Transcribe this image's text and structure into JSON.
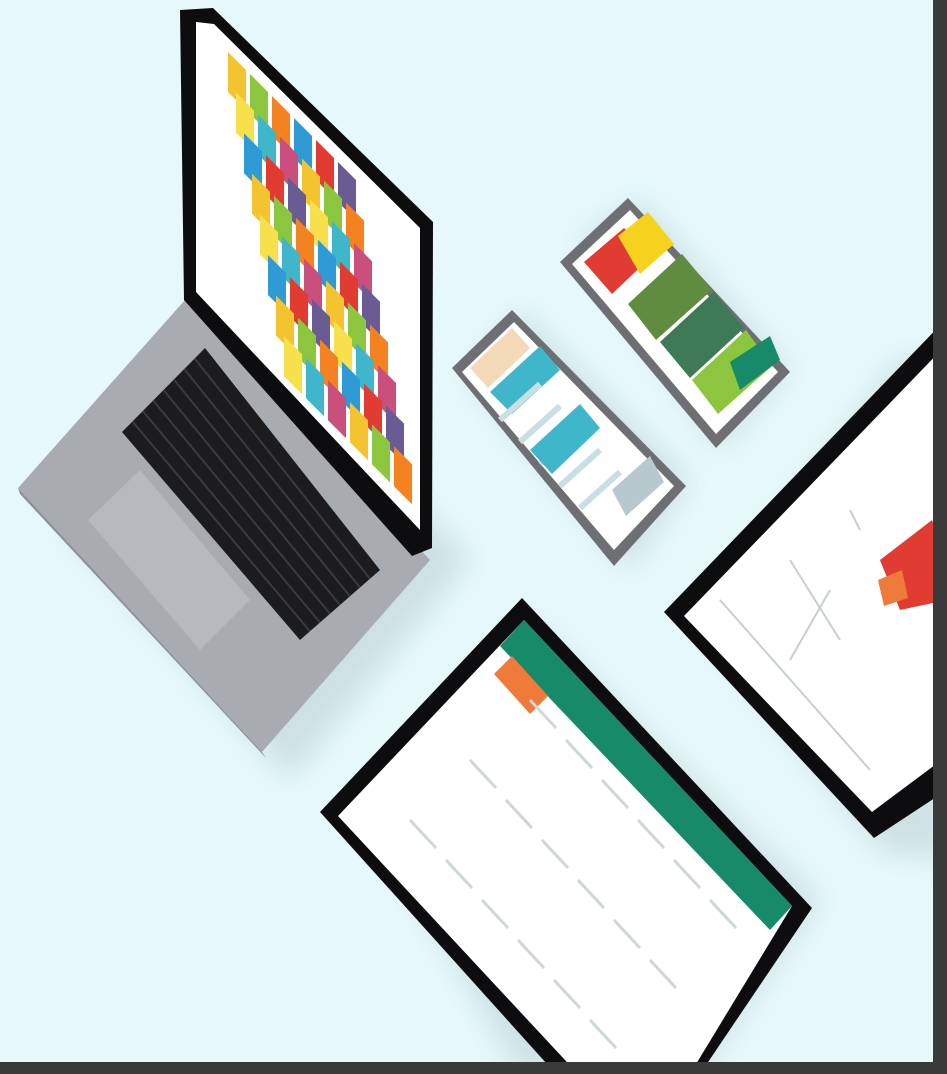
{
  "scene": {
    "background": "#e6f8fa",
    "right_edge_color": "#3a3a3a",
    "bottom_edge_color": "#3a3a3a",
    "palette": {
      "laptop_body": "#a8abb0",
      "laptop_body_shadow": "#8e9196",
      "keyboard": "#1c1c1e",
      "bezel": "#0d0d0f",
      "screen": "#ffffff",
      "accent_green": "#178a6a",
      "accent_orange": "#f07a3a",
      "tile_colors": [
        "#f4c430",
        "#8cc63f",
        "#f58220",
        "#2e9bd6",
        "#e03c31",
        "#6b5b95",
        "#f7e04b",
        "#3fb6c9",
        "#c94f7c"
      ]
    },
    "devices": [
      "laptop-with-tile-grid",
      "phone-with-list",
      "phone-with-gallery",
      "tablet-with-chart",
      "tablet-with-table"
    ]
  }
}
